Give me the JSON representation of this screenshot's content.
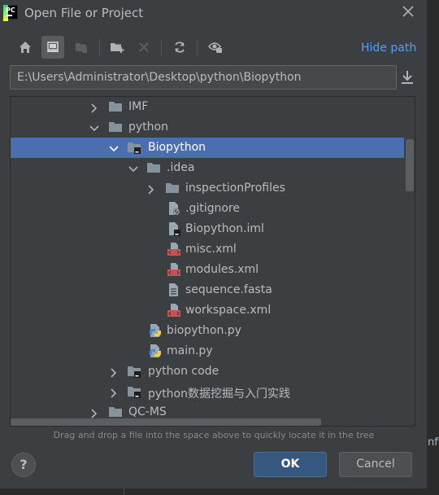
{
  "window": {
    "title": "Open File or Project",
    "app_icon_text": "PC"
  },
  "toolbar": {
    "buttons": [
      "home-icon",
      "desktop-icon",
      "project-icon",
      "new-folder-icon",
      "delete-icon",
      "refresh-icon",
      "show-hidden-icon"
    ],
    "hide_path": "Hide path"
  },
  "path": {
    "value": "E:\\Users\\Administrator\\Desktop\\python\\Biopython"
  },
  "tree": {
    "rows": [
      {
        "label": "IMF",
        "type": "folder",
        "state": "collapsed"
      },
      {
        "label": "python",
        "type": "folder",
        "state": "expanded"
      },
      {
        "label": "Biopython",
        "type": "project-folder",
        "state": "expanded",
        "selected": true
      },
      {
        "label": ".idea",
        "type": "folder",
        "state": "expanded"
      },
      {
        "label": "inspectionProfiles",
        "type": "folder",
        "state": "collapsed"
      },
      {
        "label": ".gitignore",
        "type": "ignored-file"
      },
      {
        "label": "Biopython.iml",
        "type": "iml-file"
      },
      {
        "label": "misc.xml",
        "type": "xml-file"
      },
      {
        "label": "modules.xml",
        "type": "xml-file"
      },
      {
        "label": "sequence.fasta",
        "type": "text-file"
      },
      {
        "label": "workspace.xml",
        "type": "xml-file"
      },
      {
        "label": "biopython.py",
        "type": "python-file"
      },
      {
        "label": "main.py",
        "type": "python-file"
      },
      {
        "label": "python code",
        "type": "project-folder",
        "state": "collapsed"
      },
      {
        "label": "python数据挖掘与入门实践",
        "type": "project-folder",
        "state": "collapsed"
      },
      {
        "label": "QC-MS",
        "type": "folder",
        "state": "collapsed"
      }
    ]
  },
  "hint": "Drag and drop a file into the space above to quickly locate it in the tree",
  "buttons": {
    "help": "?",
    "ok": "OK",
    "cancel": "Cancel"
  },
  "background_peek": "nfi",
  "colors": {
    "selection": "#4b6eaf",
    "accent": "#589df6",
    "dialog_bg": "#3c3f41",
    "ok_bg": "#365880"
  }
}
